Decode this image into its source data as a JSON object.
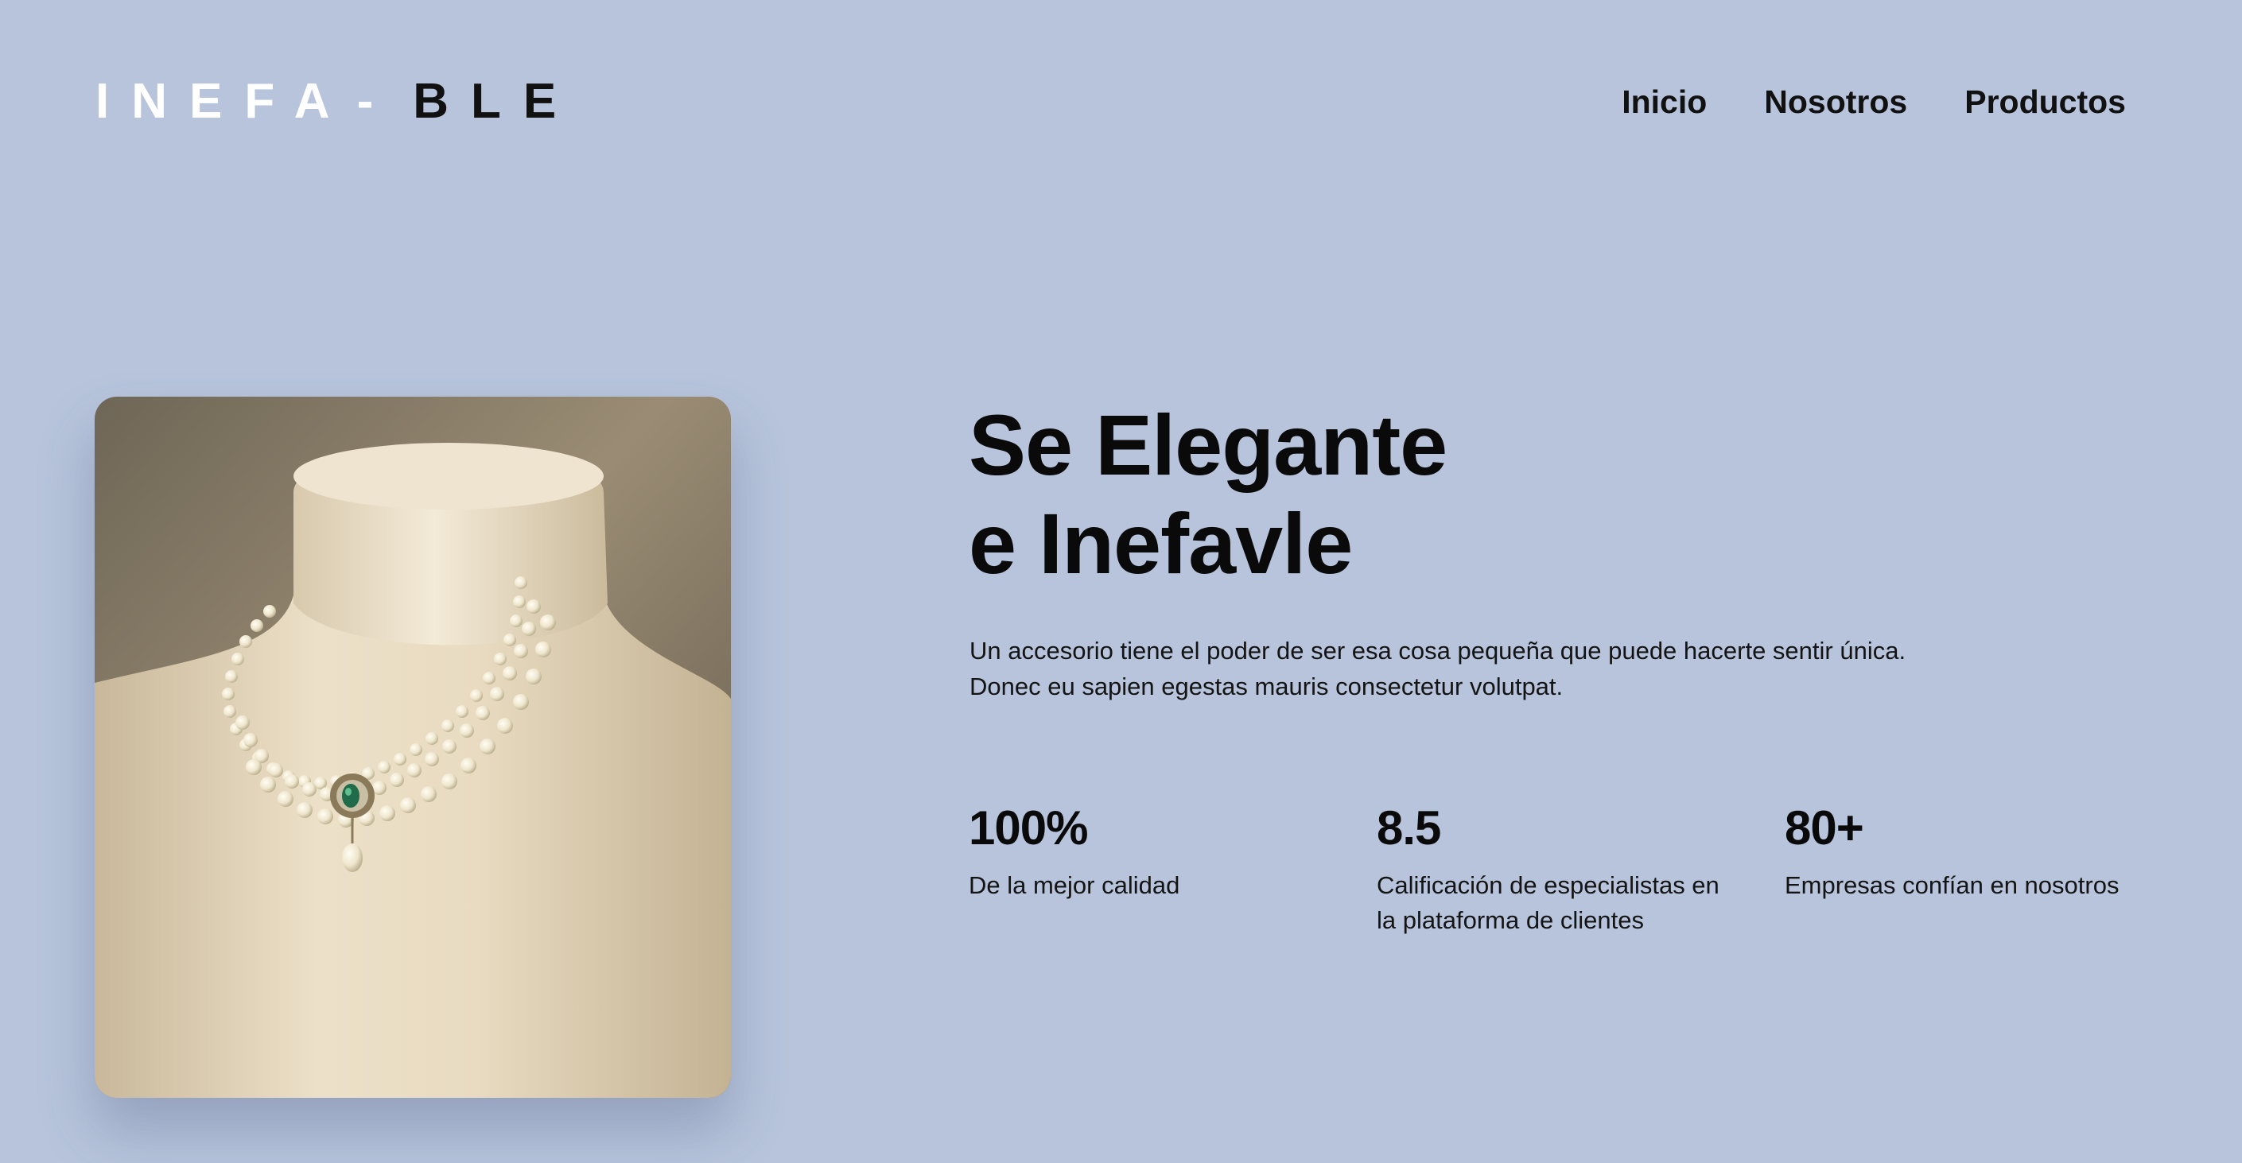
{
  "header": {
    "logo_part_a": "INEFA",
    "logo_dash": "-",
    "logo_part_b": "BLE",
    "nav": [
      {
        "label": "Inicio"
      },
      {
        "label": "Nosotros"
      },
      {
        "label": "Productos"
      }
    ]
  },
  "hero": {
    "image_icon": "pearl-necklace-photo",
    "title_line1": "Se Elegante",
    "title_line2": "e Inefavle",
    "description_line1": "Un accesorio tiene el poder de ser esa cosa pequeña que puede hacerte sentir única.",
    "description_line2": "Donec eu sapien egestas mauris consectetur volutpat."
  },
  "stats": [
    {
      "value": "100%",
      "label_line1": "De la mejor calidad",
      "label_line2": ""
    },
    {
      "value": "8.5",
      "label_line1": "Calificación de especialistas en",
      "label_line2": "la plataforma de clientes"
    },
    {
      "value": "80+",
      "label_line1": "Empresas confían en nosotros",
      "label_line2": ""
    }
  ],
  "colors": {
    "background": "#b7c4dc",
    "text": "#111111",
    "logo_light": "#ffffff"
  }
}
